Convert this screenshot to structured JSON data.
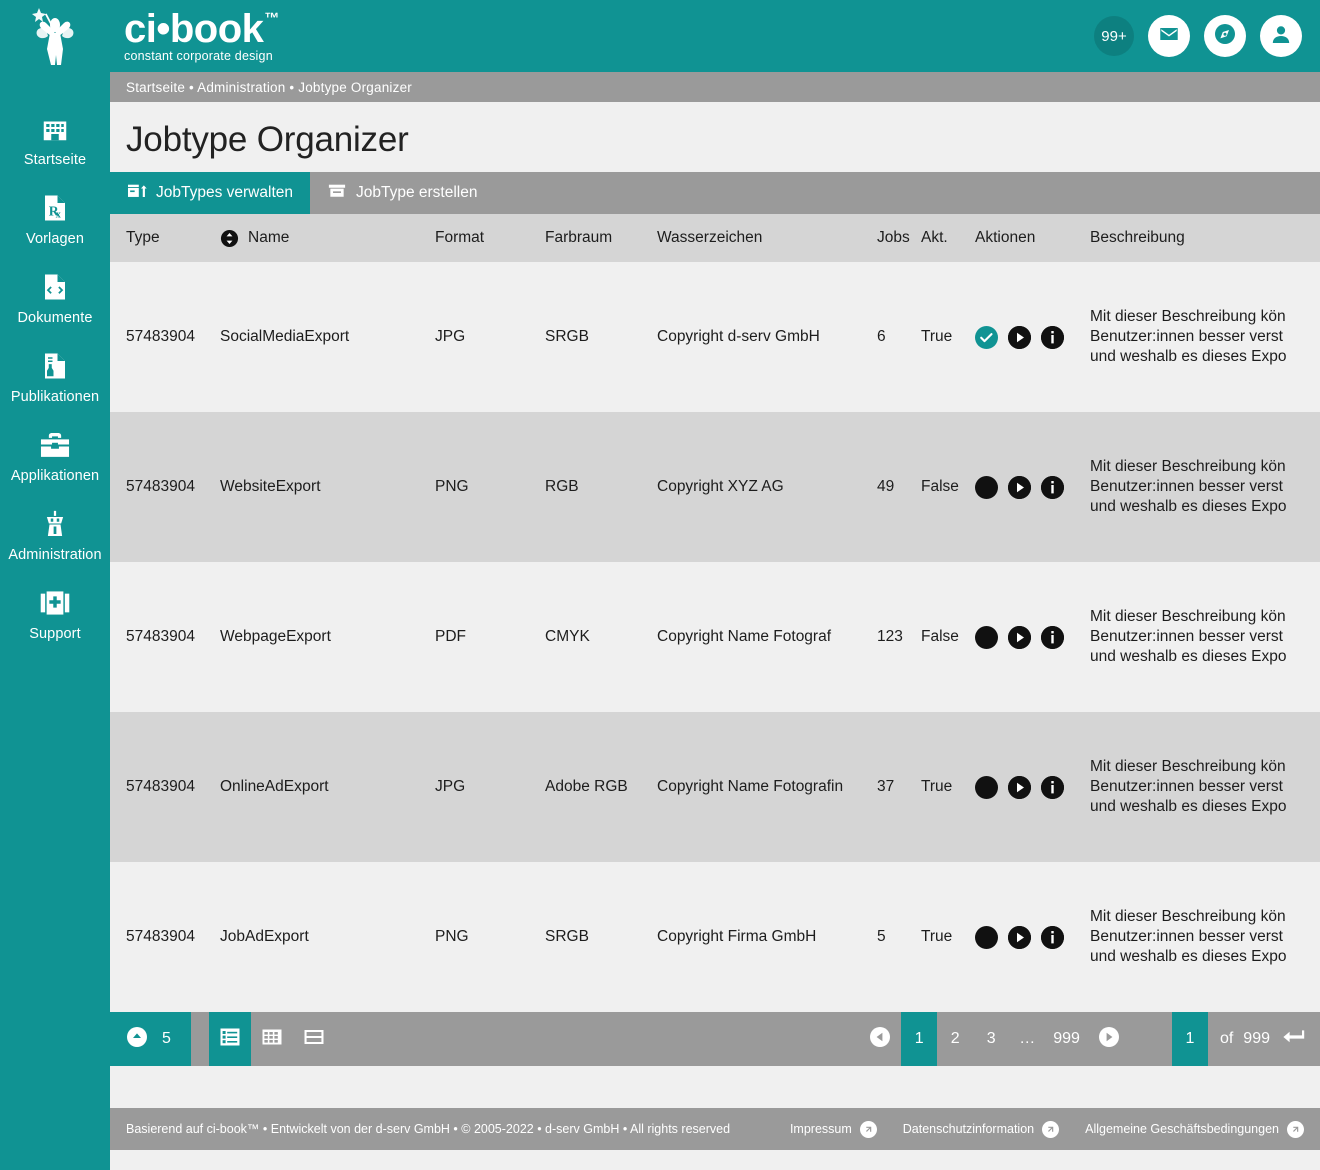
{
  "brand": {
    "name": "ci•book",
    "tm": "™",
    "tagline": "constant corporate design",
    "logo_icon": "fairy-logo-icon"
  },
  "topbar": {
    "notification_badge": "99+",
    "mail_icon": "envelope-icon",
    "compass_icon": "compass-icon",
    "account_icon": "user-avatar-icon"
  },
  "breadcrumb": "Startseite • Administration • Jobtype Organizer",
  "page_title": "Jobtype Organizer",
  "sidebar": {
    "items": [
      {
        "label": "Startseite",
        "icon": "building-icon"
      },
      {
        "label": "Vorlagen",
        "icon": "prescription-document-icon"
      },
      {
        "label": "Dokumente",
        "icon": "code-document-icon"
      },
      {
        "label": "Publikationen",
        "icon": "publication-document-icon"
      },
      {
        "label": "Applikationen",
        "icon": "toolbox-icon"
      },
      {
        "label": "Administration",
        "icon": "control-tower-icon"
      },
      {
        "label": "Support",
        "icon": "first-aid-kit-icon"
      }
    ]
  },
  "tabs": [
    {
      "label": "JobTypes verwalten",
      "icon": "manage-jobtypes-icon",
      "active": true
    },
    {
      "label": "JobType erstellen",
      "icon": "create-jobtype-icon",
      "active": false
    }
  ],
  "table": {
    "columns": [
      {
        "key": "type",
        "label": "Type"
      },
      {
        "key": "name",
        "label": "Name",
        "sortable": true,
        "sort_icon": "sort-updown-icon"
      },
      {
        "key": "format",
        "label": "Format"
      },
      {
        "key": "color",
        "label": "Farbraum"
      },
      {
        "key": "water",
        "label": "Wasserzeichen"
      },
      {
        "key": "jobs",
        "label": "Jobs"
      },
      {
        "key": "akt",
        "label": "Akt."
      },
      {
        "key": "aktion",
        "label": "Aktionen"
      },
      {
        "key": "desc",
        "label": "Beschreibung"
      }
    ],
    "description_lines": [
      "Mit dieser Beschreibung kön",
      "Benutzer:innen besser verst",
      "und weshalb es dieses Expo"
    ],
    "rows": [
      {
        "type": "57483904",
        "name": "SocialMediaExport",
        "format": "JPG",
        "color": "SRGB",
        "water": "Copyright d-serv GmbH",
        "jobs": "6",
        "akt": "True",
        "status_active": true
      },
      {
        "type": "57483904",
        "name": "WebsiteExport",
        "format": "PNG",
        "color": "RGB",
        "water": "Copyright XYZ AG",
        "jobs": "49",
        "akt": "False",
        "status_active": false
      },
      {
        "type": "57483904",
        "name": "WebpageExport",
        "format": "PDF",
        "color": "CMYK",
        "water": "Copyright Name Fotograf",
        "jobs": "123",
        "akt": "False",
        "status_active": false
      },
      {
        "type": "57483904",
        "name": "OnlineAdExport",
        "format": "JPG",
        "color": "Adobe RGB",
        "water": "Copyright Name Fotografin",
        "jobs": "37",
        "akt": "True",
        "status_active": false
      },
      {
        "type": "57483904",
        "name": "JobAdExport",
        "format": "PNG",
        "color": "SRGB",
        "water": "Copyright Firma GmbH",
        "jobs": "5",
        "akt": "True",
        "status_active": false
      }
    ],
    "action_icons": {
      "status": "check-circle-icon",
      "run": "play-circle-icon",
      "info": "info-circle-icon"
    }
  },
  "pagination": {
    "rows_per_page": "5",
    "rows_icon": "chevron-up-circle-icon",
    "views": [
      {
        "icon": "list-view-icon",
        "active": true
      },
      {
        "icon": "grid-view-icon",
        "active": false
      },
      {
        "icon": "split-view-icon",
        "active": false
      }
    ],
    "prev_icon": "arrow-left-circle-icon",
    "next_icon": "arrow-right-circle-icon",
    "pages": [
      "1",
      "2",
      "3",
      "…",
      "999"
    ],
    "current_page": "1",
    "jump_value": "1",
    "of_label": "of",
    "total_pages": "999",
    "enter_icon": "enter-return-icon"
  },
  "footer": {
    "copyright": "Basierend auf ci-book™ • Entwickelt von der d-serv GmbH • © 2005-2022 • d-serv GmbH • All rights reserved",
    "links": [
      {
        "label": "Impressum",
        "icon": "external-link-icon"
      },
      {
        "label": "Datenschutzinformation",
        "icon": "external-link-icon"
      },
      {
        "label": "Allgemeine Geschäftsbedingungen",
        "icon": "external-link-icon"
      }
    ]
  },
  "colors": {
    "teal": "#109393",
    "gray_bar": "#9a9a9a",
    "header_row": "#d5d5d5",
    "row_light": "#f0f0f0",
    "row_dark": "#d5d5d5"
  }
}
